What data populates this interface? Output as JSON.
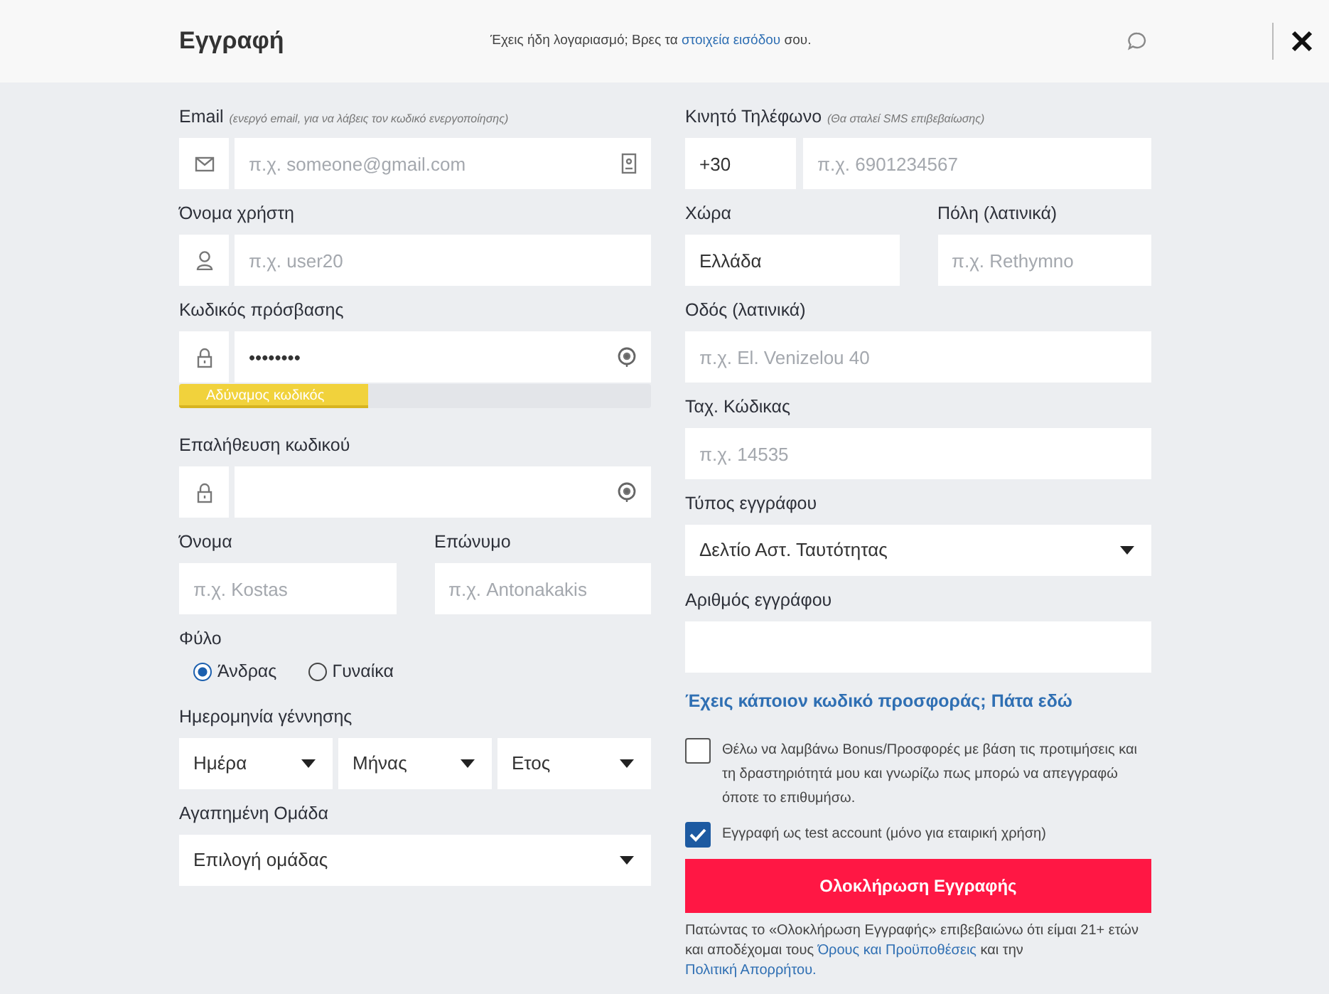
{
  "header": {
    "title": "Εγγραφή",
    "prompt": [
      {
        "kind": "text",
        "text": "Έχεις ήδη λογαριασμό; Βρες τα "
      },
      {
        "kind": "link",
        "text": "στοιχεία εισόδου"
      },
      {
        "kind": "text",
        "text": " σου."
      }
    ]
  },
  "left_column": [
    {
      "kind": "email",
      "label": "Email",
      "hint": "(ενεργό email, για να λάβεις τον κωδικό ενεργοποίησης)",
      "placeholder": "π.χ. someone@gmail.com"
    },
    {
      "kind": "username",
      "label": "Όνομα χρήστη",
      "placeholder": "π.χ. user20"
    },
    {
      "kind": "password",
      "label": "Κωδικός πρόσβασης",
      "value": "••••••••",
      "strength": {
        "label": "Αδύναμος κωδικός",
        "level": 0.4
      }
    },
    {
      "kind": "password",
      "label": "Επαλήθευση κωδικού"
    },
    {
      "kind": "pair",
      "fields": [
        {
          "label": "Όνομα",
          "placeholder": "π.χ. Kostas"
        },
        {
          "label": "Επώνυμο",
          "placeholder": "π.χ. Antonakakis"
        }
      ]
    },
    {
      "kind": "radio",
      "label": "Φύλο",
      "options": [
        {
          "label": "Άνδρας",
          "selected": true
        },
        {
          "label": "Γυναίκα",
          "selected": false
        }
      ]
    },
    {
      "kind": "date",
      "label": "Ημερομηνία γέννησης",
      "selects": [
        "Ημέρα",
        "Μήνας",
        "Ετος"
      ]
    },
    {
      "kind": "select",
      "label": "Αγαπημένη Ομάδα",
      "value": "Επιλογή ομάδας"
    }
  ],
  "right_column": [
    {
      "kind": "phone",
      "label": "Κινητό Τηλέφωνο",
      "hint": "(Θα σταλεί SMS επιβεβαίωσης)",
      "prefix": "+30",
      "placeholder": "π.χ. 6901234567"
    },
    {
      "kind": "pair",
      "fields": [
        {
          "label": "Χώρα",
          "value": "Ελλάδα"
        },
        {
          "label": "Πόλη (λατινικά)",
          "placeholder": "π.χ. Rethymno"
        }
      ]
    },
    {
      "kind": "text",
      "label": "Οδός (λατινικά)",
      "placeholder": "π.χ. El. Venizelou 40"
    },
    {
      "kind": "text",
      "label": "Ταχ. Κώδικας",
      "placeholder": "π.χ. 14535"
    },
    {
      "kind": "select",
      "label": "Τύπος εγγράφου",
      "value": "Δελτίο Αστ. Ταυτότητας"
    },
    {
      "kind": "text",
      "label": "Αριθμός εγγράφου"
    },
    {
      "kind": "link",
      "text": "Έχεις κάποιον κωδικό προσφοράς; Πάτα εδώ"
    },
    {
      "kind": "checkbox",
      "text": "Θέλω να λαμβάνω Bonus/Προσφορές με βάση τις προτιμήσεις και τη δραστηριότητά μου και γνωρίζω πως μπορώ να απεγγραφώ όποτε το επιθυμήσω.",
      "checked": false
    },
    {
      "kind": "checkbox",
      "text": "Εγγραφή ως test account (μόνο για εταιρική χρήση)",
      "checked": true
    },
    {
      "kind": "button",
      "text": "Ολοκλήρωση Εγγραφής"
    },
    {
      "kind": "terms",
      "parts": [
        {
          "kind": "text",
          "text": "Πατώντας το «Ολοκλήρωση Εγγραφής» επιβεβαιώνω ότι είμαι 21+ ετών και αποδέχομαι τους "
        },
        {
          "kind": "link",
          "text": "Όρους και Προϋποθέσεις"
        },
        {
          "kind": "text",
          "text": " και την "
        },
        {
          "kind": "link",
          "text": "Πολιτική Απορρήτου."
        }
      ]
    }
  ]
}
